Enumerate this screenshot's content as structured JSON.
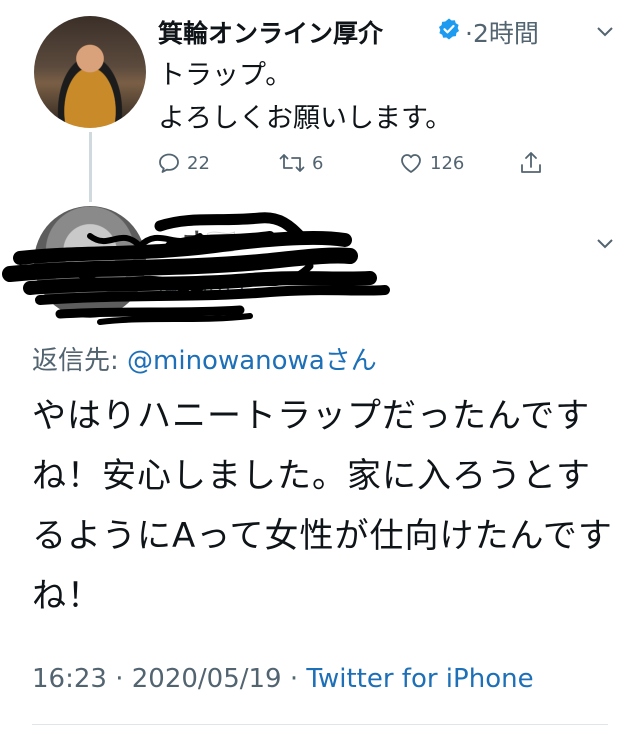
{
  "tweet": {
    "author": {
      "name": "箕輪オンライン厚介",
      "verified": true
    },
    "time": "·2時間",
    "text_lines": [
      "トラップ。",
      "よろしくお願いします。"
    ],
    "actions": {
      "reply_count": "22",
      "retweet_count": "6",
      "like_count": "126"
    }
  },
  "reply": {
    "author": {
      "name": "…オ🇯🇵",
      "handle": "@…itter",
      "redacted": true
    },
    "reply_to_label": "返信先:",
    "reply_to_user": "@minowanowaさん",
    "text": "やはりハニートラップだったんですね！安心しました。家に入ろうとするようにAって女性が仕向けたんですね！",
    "meta": {
      "time": "16:23",
      "separator": "·",
      "date": "2020/05/19",
      "source": "Twitter for iPhone"
    }
  },
  "colors": {
    "link": "#1d70b8",
    "secondary_text": "#536471",
    "verified_badge": "#1d9bf0"
  }
}
